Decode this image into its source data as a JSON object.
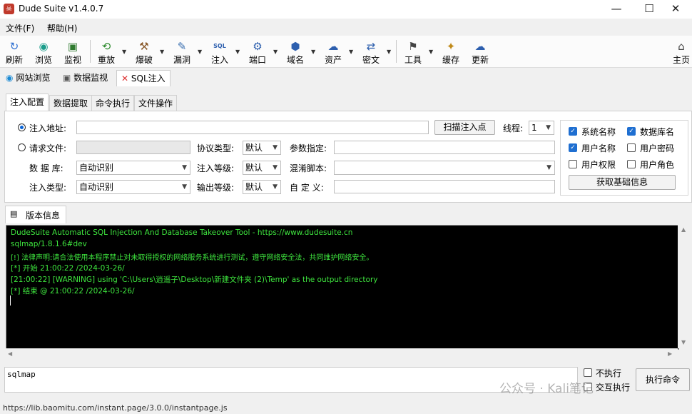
{
  "window": {
    "title": "Dude Suite v1.4.0.7",
    "minimize": "—",
    "maximize": "☐",
    "close": "✕"
  },
  "menu": [
    "文件(F)",
    "帮助(H)"
  ],
  "toolbar": {
    "items": [
      {
        "label": "刷新",
        "icon": "refresh-icon",
        "glyph": "↻"
      },
      {
        "label": "浏览",
        "icon": "browser-icon",
        "glyph": "◉"
      },
      {
        "label": "监视",
        "icon": "monitor-icon",
        "glyph": "▣"
      },
      {
        "label": "重放",
        "icon": "replay-icon",
        "glyph": "⟲"
      },
      {
        "label": "爆破",
        "icon": "hammer-icon",
        "glyph": "⚒"
      },
      {
        "label": "漏洞",
        "icon": "bug-icon",
        "glyph": "✎"
      },
      {
        "label": "注入",
        "icon": "sql-icon",
        "glyph": "SQL"
      },
      {
        "label": "端口",
        "icon": "port-icon",
        "glyph": "⚙"
      },
      {
        "label": "域名",
        "icon": "domain-icon",
        "glyph": "⬢"
      },
      {
        "label": "资产",
        "icon": "asset-icon",
        "glyph": "☁"
      },
      {
        "label": "密文",
        "icon": "cipher-icon",
        "glyph": "⇄"
      },
      {
        "label": "工具",
        "icon": "tools-icon",
        "glyph": "⚑"
      },
      {
        "label": "缓存",
        "icon": "broom-icon",
        "glyph": "✦"
      },
      {
        "label": "更新",
        "icon": "update-icon",
        "glyph": "☁"
      },
      {
        "label": "主页",
        "icon": "home-icon",
        "glyph": "⌂"
      }
    ]
  },
  "doc_tabs": [
    {
      "label": "网站浏览",
      "icon": "edge-icon"
    },
    {
      "label": "数据监视",
      "icon": "monitor-icon"
    },
    {
      "label": "SQL注入",
      "icon": "close-icon"
    }
  ],
  "inner_tabs": [
    "注入配置",
    "数据提取",
    "命令执行",
    "文件操作"
  ],
  "form": {
    "target_url_label": "注入地址:",
    "target_url_value": "",
    "scan_button": "扫描注入点",
    "threads_label": "线程:",
    "threads_value": "1",
    "request_file_label": "请求文件:",
    "protocol_label": "协议类型:",
    "protocol_value": "默认",
    "param_label": "参数指定:",
    "db_label": "数 据 库:",
    "db_value": "自动识别",
    "level_label": "注入等级:",
    "level_value": "默认",
    "tamper_label": "混淆脚本:",
    "tamper_value": "",
    "type_label": "注入类型:",
    "type_value": "自动识别",
    "verbose_label": "输出等级:",
    "verbose_value": "默认",
    "custom_label": "自 定 义:"
  },
  "checks": {
    "items": [
      {
        "label": "系统名称",
        "checked": true
      },
      {
        "label": "数据库名",
        "checked": true
      },
      {
        "label": "用户名称",
        "checked": true
      },
      {
        "label": "用户密码",
        "checked": false
      },
      {
        "label": "用户权限",
        "checked": false
      },
      {
        "label": "用户角色",
        "checked": false
      }
    ],
    "fetch_button": "获取基础信息"
  },
  "version_tab": "版本信息",
  "console": [
    "DudeSuite Automatic SQL Injection And Database Takeover Tool - https://www.dudesuite.cn",
    "sqlmap/1.8.1.6#dev",
    "[!] 法律声明:请合法使用本程序禁止对未取得授权的网络服务系统进行测试，遵守网络安全法，共同维护网络安全。",
    "[*] 开始 21:00:22 /2024-03-26/",
    "[21:00:22] [WARNING] using 'C:\\Users\\逍遥子\\Desktop\\新建文件夹 (2)\\Temp' as the output directory",
    "[*] 结束 @ 21:00:22 /2024-03-26/"
  ],
  "command": {
    "value": "sqlmap",
    "no_exec": "不执行",
    "interactive": "交互执行",
    "exec_button": "执行命令"
  },
  "watermark": "公众号 · Kali笔记",
  "status": "https://lib.baomitu.com/instant.page/3.0.0/instantpage.js"
}
